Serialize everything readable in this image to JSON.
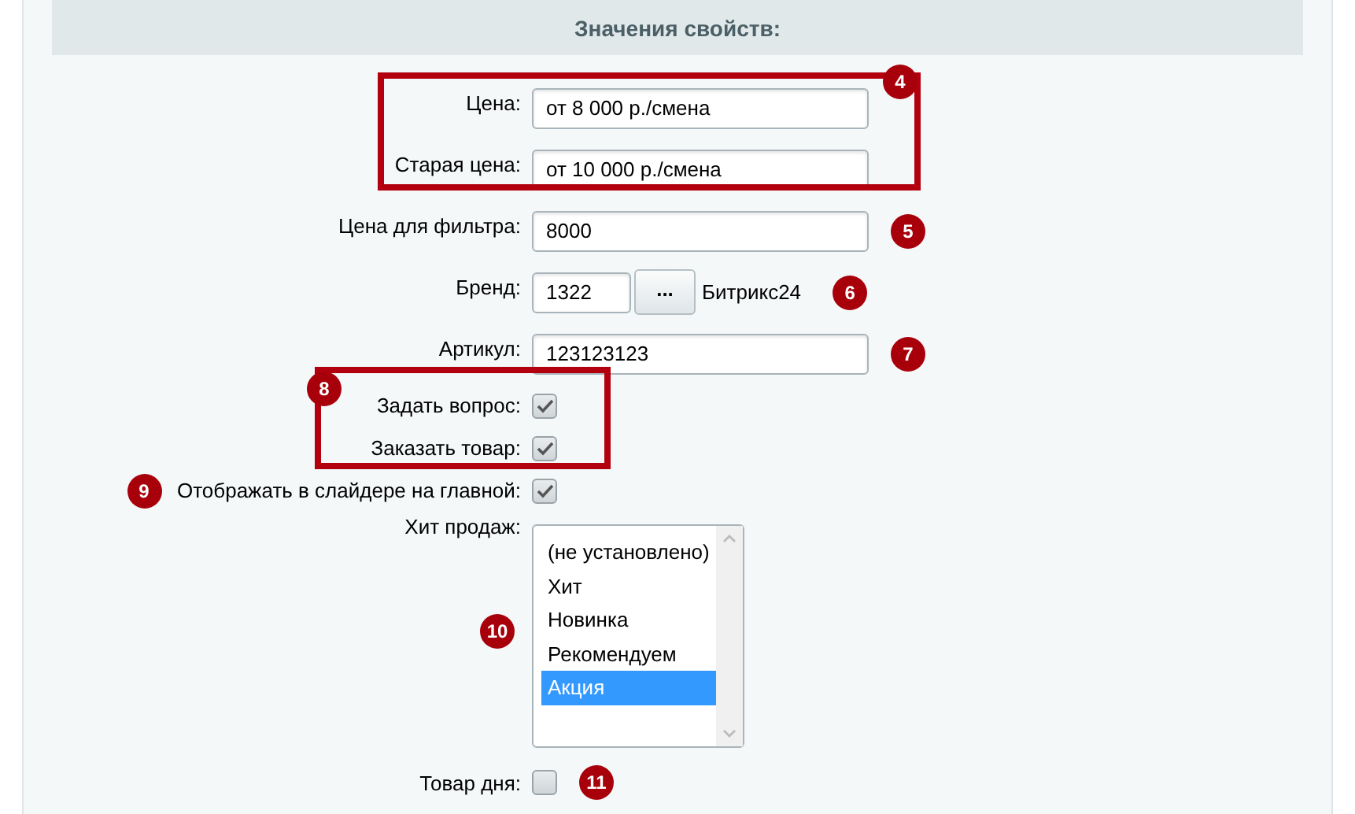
{
  "header": {
    "title": "Значения свойств:"
  },
  "sections": [
    {
      "kind": "group",
      "badge": "4",
      "rows": [
        {
          "kind": "text",
          "label": "Цена:",
          "value": "от 8 000 р./смена"
        },
        {
          "kind": "text",
          "label": "Старая цена:",
          "value": "от 10 000 р./смена"
        }
      ]
    },
    {
      "kind": "text",
      "label": "Цена для фильтра:",
      "value": "8000",
      "badge": "5"
    },
    {
      "kind": "brand",
      "label": "Бренд:",
      "value": "1322",
      "button": "...",
      "link": "Битрикс24",
      "badge": "6"
    },
    {
      "kind": "text",
      "label": "Артикул:",
      "value": "123123123",
      "badge": "7"
    },
    {
      "kind": "group",
      "badge": "8",
      "rows": [
        {
          "kind": "checkbox",
          "label": "Задать вопрос:",
          "checked": true
        },
        {
          "kind": "checkbox",
          "label": "Заказать товар:",
          "checked": true
        }
      ]
    },
    {
      "kind": "checkbox",
      "label": "Отображать в слайдере на главной:",
      "checked": true,
      "lead_badge": "9"
    },
    {
      "kind": "list",
      "label": "Хит продаж:",
      "badge": "10",
      "options": [
        {
          "label": "(не установлено)",
          "selected": false
        },
        {
          "label": "Хит",
          "selected": false
        },
        {
          "label": "Новинка",
          "selected": false
        },
        {
          "label": "Рекомендуем",
          "selected": false
        },
        {
          "label": "Акция",
          "selected": true
        }
      ]
    },
    {
      "kind": "checkbox",
      "label": "Товар дня:",
      "checked": false,
      "badge": "11"
    }
  ]
}
